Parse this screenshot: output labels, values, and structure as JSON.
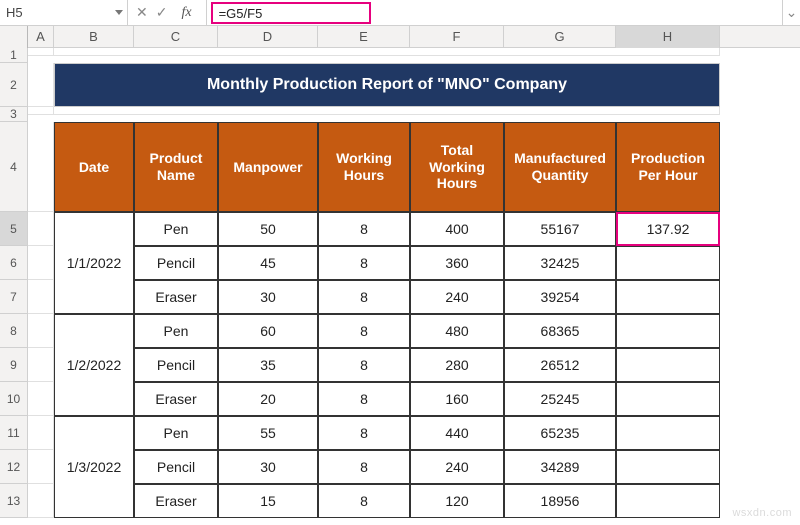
{
  "namebox": "H5",
  "formula": "=G5/F5",
  "columns": [
    "",
    "A",
    "B",
    "C",
    "D",
    "E",
    "F",
    "G",
    "H"
  ],
  "active_col_index": 8,
  "row_numbers": [
    1,
    2,
    3,
    4,
    5,
    6,
    7,
    8,
    9,
    10,
    11,
    12,
    13
  ],
  "active_row_index": 5,
  "title": "Monthly Production Report of \"MNO\" Company",
  "headers": {
    "date": "Date",
    "product": "Product Name",
    "manpower": "Manpower",
    "hours": "Working Hours",
    "total_hours": "Total Working Hours",
    "qty": "Manufactured Quantity",
    "pph": "Production Per Hour"
  },
  "blocks": [
    {
      "date": "1/1/2022",
      "rows": [
        {
          "product": "Pen",
          "manpower": 50,
          "hours": 8,
          "total_hours": 400,
          "qty": 55167,
          "pph": "137.92"
        },
        {
          "product": "Pencil",
          "manpower": 45,
          "hours": 8,
          "total_hours": 360,
          "qty": 32425,
          "pph": ""
        },
        {
          "product": "Eraser",
          "manpower": 30,
          "hours": 8,
          "total_hours": 240,
          "qty": 39254,
          "pph": ""
        }
      ]
    },
    {
      "date": "1/2/2022",
      "rows": [
        {
          "product": "Pen",
          "manpower": 60,
          "hours": 8,
          "total_hours": 480,
          "qty": 68365,
          "pph": ""
        },
        {
          "product": "Pencil",
          "manpower": 35,
          "hours": 8,
          "total_hours": 280,
          "qty": 26512,
          "pph": ""
        },
        {
          "product": "Eraser",
          "manpower": 20,
          "hours": 8,
          "total_hours": 160,
          "qty": 25245,
          "pph": ""
        }
      ]
    },
    {
      "date": "1/3/2022",
      "rows": [
        {
          "product": "Pen",
          "manpower": 55,
          "hours": 8,
          "total_hours": 440,
          "qty": 65235,
          "pph": ""
        },
        {
          "product": "Pencil",
          "manpower": 30,
          "hours": 8,
          "total_hours": 240,
          "qty": 34289,
          "pph": ""
        },
        {
          "product": "Eraser",
          "manpower": 15,
          "hours": 8,
          "total_hours": 120,
          "qty": 18956,
          "pph": ""
        }
      ]
    }
  ],
  "watermark": "wsxdn.com",
  "chart_data": {
    "type": "table",
    "title": "Monthly Production Report of \"MNO\" Company",
    "columns": [
      "Date",
      "Product Name",
      "Manpower",
      "Working Hours",
      "Total Working Hours",
      "Manufactured Quantity",
      "Production Per Hour"
    ],
    "rows": [
      [
        "1/1/2022",
        "Pen",
        50,
        8,
        400,
        55167,
        137.92
      ],
      [
        "1/1/2022",
        "Pencil",
        45,
        8,
        360,
        32425,
        null
      ],
      [
        "1/1/2022",
        "Eraser",
        30,
        8,
        240,
        39254,
        null
      ],
      [
        "1/2/2022",
        "Pen",
        60,
        8,
        480,
        68365,
        null
      ],
      [
        "1/2/2022",
        "Pencil",
        35,
        8,
        280,
        26512,
        null
      ],
      [
        "1/2/2022",
        "Eraser",
        20,
        8,
        160,
        25245,
        null
      ],
      [
        "1/3/2022",
        "Pen",
        55,
        8,
        440,
        65235,
        null
      ],
      [
        "1/3/2022",
        "Pencil",
        30,
        8,
        240,
        34289,
        null
      ],
      [
        "1/3/2022",
        "Eraser",
        15,
        8,
        120,
        18956,
        null
      ]
    ]
  }
}
